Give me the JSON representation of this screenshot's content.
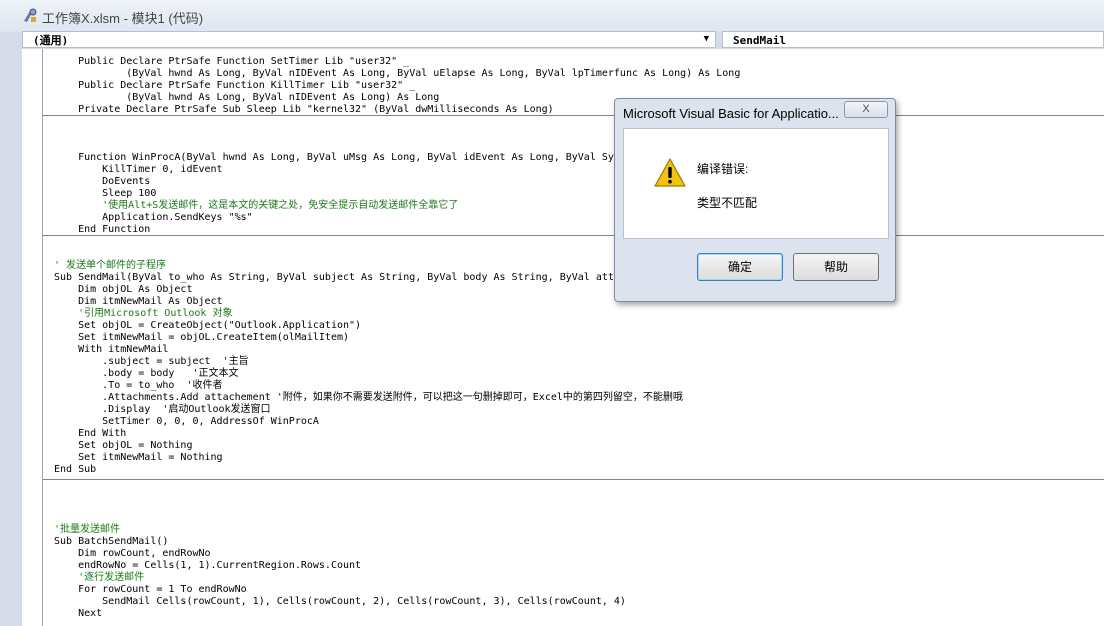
{
  "window": {
    "title": "工作簿X.xlsm - 模块1 (代码)"
  },
  "combos": {
    "object": "(通用)",
    "procedure": "SendMail"
  },
  "code_lines": [
    {
      "text": "    Public Declare PtrSafe Function SetTimer Lib \"user32\" _",
      "kind": "code"
    },
    {
      "text": "            (ByVal hwnd As Long, ByVal nIDEvent As Long, ByVal uElapse As Long, ByVal lpTimerfunc As Long) As Long",
      "kind": "code"
    },
    {
      "text": "    Public Declare PtrSafe Function KillTimer Lib \"user32\" _",
      "kind": "code"
    },
    {
      "text": "            (ByVal hwnd As Long, ByVal nIDEvent As Long) As Long",
      "kind": "code"
    },
    {
      "text": "    Private Declare PtrSafe Sub Sleep Lib \"kernel32\" (ByVal dwMilliseconds As Long)",
      "kind": "code"
    },
    {
      "text": "",
      "kind": "code"
    },
    {
      "text": "",
      "kind": "code"
    },
    {
      "text": "",
      "kind": "code"
    },
    {
      "text": "    Function WinProcA(ByVal hwnd As Long, ByVal uMsg As Long, ByVal idEvent As Long, ByVal Sys",
      "kind": "code"
    },
    {
      "text": "        KillTimer 0, idEvent",
      "kind": "code"
    },
    {
      "text": "        DoEvents",
      "kind": "code"
    },
    {
      "text": "        Sleep 100",
      "kind": "code"
    },
    {
      "text": "        '使用Alt+S发送邮件，这是本文的关键之处，免安全提示自动发送邮件全靠它了",
      "kind": "comment"
    },
    {
      "text": "        Application.SendKeys \"%s\"",
      "kind": "code"
    },
    {
      "text": "    End Function",
      "kind": "code"
    },
    {
      "text": "",
      "kind": "code"
    },
    {
      "text": "",
      "kind": "code"
    },
    {
      "text": "' 发送单个邮件的子程序",
      "kind": "comment"
    },
    {
      "text": "Sub SendMail(ByVal to_who As String, ByVal subject As String, ByVal body As String, ByVal atta",
      "kind": "code"
    },
    {
      "text": "    Dim objOL As Object",
      "kind": "code"
    },
    {
      "text": "    Dim itmNewMail As Object",
      "kind": "code"
    },
    {
      "text": "    '引用Microsoft Outlook 对象",
      "kind": "comment"
    },
    {
      "text": "    Set objOL = CreateObject(\"Outlook.Application\")",
      "kind": "code"
    },
    {
      "text": "    Set itmNewMail = objOL.CreateItem(olMailItem)",
      "kind": "code"
    },
    {
      "text": "    With itmNewMail",
      "kind": "code"
    },
    {
      "text": "        .subject = subject  '主旨",
      "kind": "code"
    },
    {
      "text": "        .body = body   '正文本文",
      "kind": "code"
    },
    {
      "text": "        .To = to_who  '收件者",
      "kind": "code"
    },
    {
      "text": "        .Attachments.Add attachement '附件，如果你不需要发送附件，可以把这一句删掉即可，Excel中的第四列留空，不能删哦",
      "kind": "code"
    },
    {
      "text": "        .Display  '启动Outlook发送窗口",
      "kind": "code"
    },
    {
      "text": "        SetTimer 0, 0, 0, AddressOf WinProcA",
      "kind": "code"
    },
    {
      "text": "    End With",
      "kind": "code"
    },
    {
      "text": "    Set objOL = Nothing",
      "kind": "code"
    },
    {
      "text": "    Set itmNewMail = Nothing",
      "kind": "code"
    },
    {
      "text": "End Sub",
      "kind": "code"
    },
    {
      "text": "",
      "kind": "code"
    },
    {
      "text": "",
      "kind": "code"
    },
    {
      "text": "",
      "kind": "code"
    },
    {
      "text": "",
      "kind": "code"
    },
    {
      "text": "'批量发送邮件",
      "kind": "comment"
    },
    {
      "text": "Sub BatchSendMail()",
      "kind": "code"
    },
    {
      "text": "    Dim rowCount, endRowNo",
      "kind": "code"
    },
    {
      "text": "    endRowNo = Cells(1, 1).CurrentRegion.Rows.Count",
      "kind": "code"
    },
    {
      "text": "    '逐行发送邮件",
      "kind": "comment"
    },
    {
      "text": "    For rowCount = 1 To endRowNo",
      "kind": "code"
    },
    {
      "text": "        SendMail Cells(rowCount, 1), Cells(rowCount, 2), Cells(rowCount, 3), Cells(rowCount, 4)",
      "kind": "code"
    },
    {
      "text": "    Next",
      "kind": "code"
    }
  ],
  "dialog": {
    "title": "Microsoft Visual Basic for Applicatio...",
    "heading": "编译错误:",
    "message": "类型不匹配",
    "ok_label": "确定",
    "help_label": "帮助",
    "close_label": "X",
    "icon": "warning-icon"
  },
  "colors": {
    "comment": "#1a7a1a",
    "code": "#000000"
  }
}
